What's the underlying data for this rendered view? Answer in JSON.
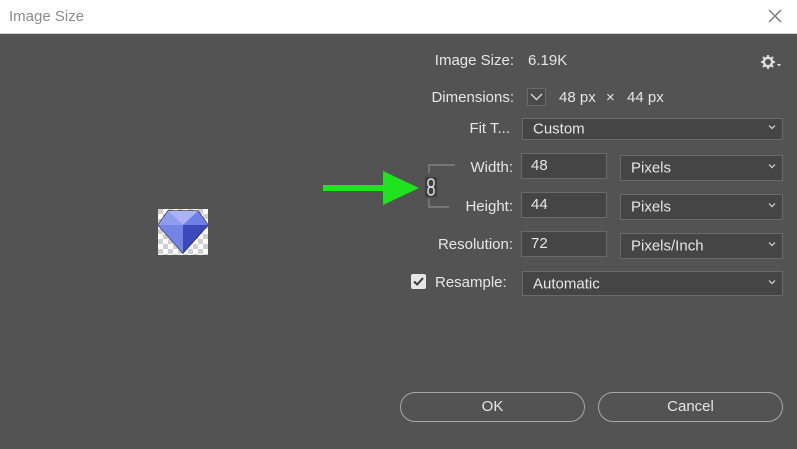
{
  "window": {
    "title": "Image Size"
  },
  "info": {
    "image_size_label": "Image Size:",
    "image_size_value": "6.19K",
    "dimensions_label": "Dimensions:",
    "dim_width": "48 px",
    "dim_sep": "×",
    "dim_height": "44 px"
  },
  "fit": {
    "label": "Fit T...",
    "value": "Custom"
  },
  "width": {
    "label": "Width:",
    "value": "48",
    "unit": "Pixels"
  },
  "height": {
    "label": "Height:",
    "value": "44",
    "unit": "Pixels"
  },
  "resolution": {
    "label": "Resolution:",
    "value": "72",
    "unit": "Pixels/Inch"
  },
  "resample": {
    "label": "Resample:",
    "checked": true,
    "value": "Automatic"
  },
  "buttons": {
    "ok": "OK",
    "cancel": "Cancel"
  },
  "colors": {
    "dialog_bg": "#535353",
    "field_bg": "#454545",
    "annotation_arrow": "#1ee31e",
    "gem_blue": "#5b6ee0"
  },
  "icons": [
    "close-icon",
    "gear-icon",
    "chain-link-icon",
    "chevron-down-icon",
    "checkmark-icon",
    "arrow-right-icon"
  ]
}
